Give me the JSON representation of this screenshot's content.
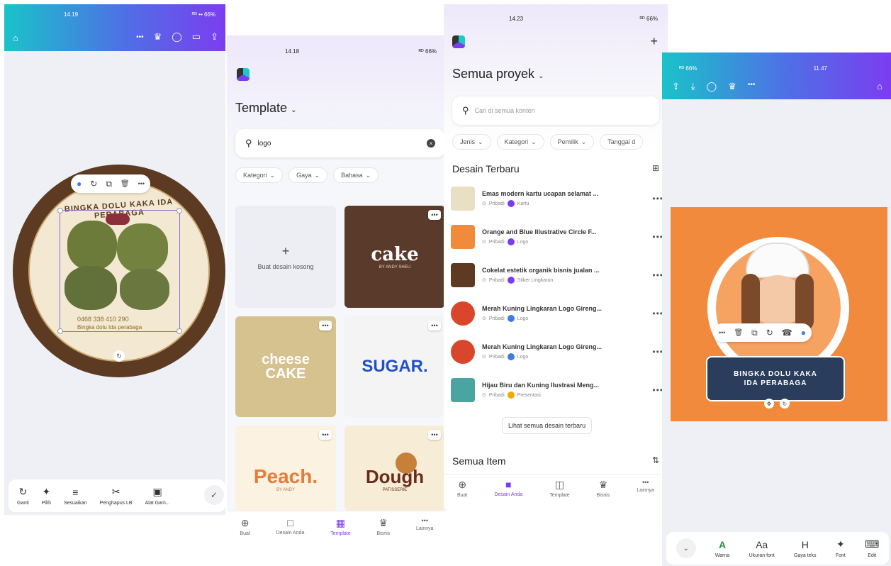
{
  "screen1": {
    "time": "14.19",
    "signal": "ᴿᴰ •• 66%",
    "menu_dots": "•••",
    "circle_text_top": "BINGKA DOLU KAKA IDA PERABAGA",
    "phone": "0468 338 410 290",
    "shop_name": "Bingka dolu Ida perabaga",
    "floating_toolbar": [
      "●",
      "↻",
      "⧉",
      "🗑",
      "•••"
    ],
    "tools": [
      {
        "icon": "↻",
        "label": "Ganti"
      },
      {
        "icon": "✦",
        "label": "Pilih"
      },
      {
        "icon": "≡",
        "label": "Sesuaikan"
      },
      {
        "icon": "✂",
        "label": "Penghapus LB"
      },
      {
        "icon": "▣",
        "label": "Alat Gam..."
      }
    ],
    "confirm_icon": "✓"
  },
  "screen2": {
    "time": "14.18",
    "signal": "ᴿᴰ 66%",
    "title": "Template",
    "search_value": "logo",
    "filters": [
      "Kategori",
      "Gaya",
      "Bahasa"
    ],
    "blank_label": "Buat desain kosong",
    "tiles": [
      {
        "name": "cake",
        "text": "cake",
        "sub": "BY ANDY SHEU",
        "bg": "#5a3a2a",
        "color": "#ffffff"
      },
      {
        "name": "cheesecake",
        "text": "cheese CAKE",
        "sub": "",
        "bg": "#d6c28e",
        "color": "#ffffff"
      },
      {
        "name": "sugar",
        "text": "SUGAR.",
        "sub": "",
        "bg": "#f4f4f4",
        "color": "#1f4fc9"
      },
      {
        "name": "peach",
        "text": "Peach.",
        "sub": "BY ANDY",
        "bg": "#fbf2e1",
        "color": "#e67c3a"
      },
      {
        "name": "dough",
        "text": "Dough",
        "sub": "PATISSERIE",
        "bg": "#f7edd7",
        "color": "#6a2c1a"
      }
    ],
    "nav": [
      {
        "icon": "⊕",
        "label": "Buat"
      },
      {
        "icon": "□",
        "label": "Desain Anda"
      },
      {
        "icon": "▦",
        "label": "Template"
      },
      {
        "icon": "♛",
        "label": "Bisnis"
      },
      {
        "icon": "•••",
        "label": "Lainnya"
      }
    ]
  },
  "screen3": {
    "time": "14.23",
    "signal": "ᴿᴰ 66%",
    "title": "Semua proyek",
    "search_placeholder": "Cari di semua konten",
    "filters": [
      "Jenis",
      "Kategori",
      "Pemilik",
      "Tanggal d"
    ],
    "section_recent": "Desain Terbaru",
    "items": [
      {
        "title": "Emas modern kartu ucapan selamat ...",
        "owner": "Pribadi",
        "type": "Kartu",
        "thumb": "#e9dfc4",
        "badge": "#7b3df0"
      },
      {
        "title": "Orange and Blue Illustrative Circle F...",
        "owner": "Pribadi",
        "type": "Logo",
        "thumb": "#f08b3b",
        "badge": "#7b3df0"
      },
      {
        "title": "Cokelat estetik organik bisnis jualan ...",
        "owner": "Pribadi",
        "type": "Stiker Lingkaran",
        "thumb": "#5c3b22",
        "badge": "#7b3df0"
      },
      {
        "title": "Merah Kuning Lingkaran Logo Gireng...",
        "owner": "Pribadi",
        "type": "Logo",
        "thumb": "#d9462b",
        "badge": "#3f7be6"
      },
      {
        "title": "Merah Kuning Lingkaran Logo Gireng...",
        "owner": "Pribadi",
        "type": "Logo",
        "thumb": "#d9462b",
        "badge": "#3f7be6"
      },
      {
        "title": "Hijau Biru dan Kuning Ilustrasi Meng...",
        "owner": "Pribadi",
        "type": "Presentasi",
        "thumb": "#4aa4a0",
        "badge": "#f2a900"
      }
    ],
    "see_all": "Lihat semua desain terbaru",
    "section_all": "Semua Item",
    "nav": [
      {
        "icon": "⊕",
        "label": "Buat"
      },
      {
        "icon": "■",
        "label": "Desain Anda"
      },
      {
        "icon": "◫",
        "label": "Template"
      },
      {
        "icon": "♛",
        "label": "Bisnis"
      },
      {
        "icon": "•••",
        "label": "Lainnya"
      }
    ]
  },
  "screen4": {
    "time": "11.47",
    "signal": "ᴿᴰ 66%",
    "banner_line1": "BINGKA DOLU KAKA",
    "banner_line2": "IDA PERABAGA",
    "floating_toolbar": [
      "•••",
      "🗑",
      "⧉",
      "↻",
      "☎",
      "●"
    ],
    "tools": [
      {
        "icon": "A",
        "label": "Warna"
      },
      {
        "icon": "Aa",
        "label": "Ukuran font"
      },
      {
        "icon": "H",
        "label": "Gaya teks"
      },
      {
        "icon": "✦",
        "label": "Font"
      },
      {
        "icon": "⌨",
        "label": "Edit"
      }
    ]
  },
  "colors": {
    "accent": "#7b3df0",
    "orange_canvas": "#f28a3d",
    "brown_ring": "#5c3b22",
    "navy_banner": "#2b3d5c"
  }
}
